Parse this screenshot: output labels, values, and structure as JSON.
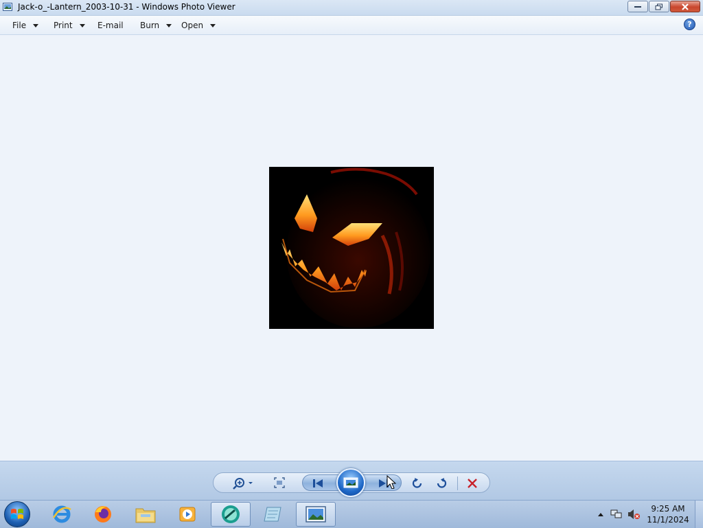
{
  "window": {
    "title": "Jack-o_-Lantern_2003-10-31 - Windows Photo Viewer"
  },
  "menu": {
    "items": [
      {
        "label": "File",
        "has_dropdown": true
      },
      {
        "label": "Print",
        "has_dropdown": true
      },
      {
        "label": "E-mail",
        "has_dropdown": false
      },
      {
        "label": "Burn",
        "has_dropdown": true
      },
      {
        "label": "Open",
        "has_dropdown": true
      }
    ],
    "help_glyph": "?"
  },
  "controls": {
    "icons": [
      "zoom-icon",
      "actual-size-icon",
      "previous-icon",
      "slideshow-icon",
      "next-icon",
      "rotate-counterclockwise-icon",
      "rotate-clockwise-icon",
      "delete-icon"
    ]
  },
  "taskbar": {
    "pinned": [
      "internet-explorer-icon",
      "firefox-icon",
      "file-explorer-icon",
      "media-player-icon",
      "snipping-tool-icon",
      "notepad-icon",
      "photo-viewer-icon"
    ],
    "clock_time": "9:25 AM",
    "clock_date": "11/1/2024"
  },
  "colors": {
    "accent": "#1e68c8",
    "delete_red": "#c8222a",
    "background": "#eef3fa"
  }
}
